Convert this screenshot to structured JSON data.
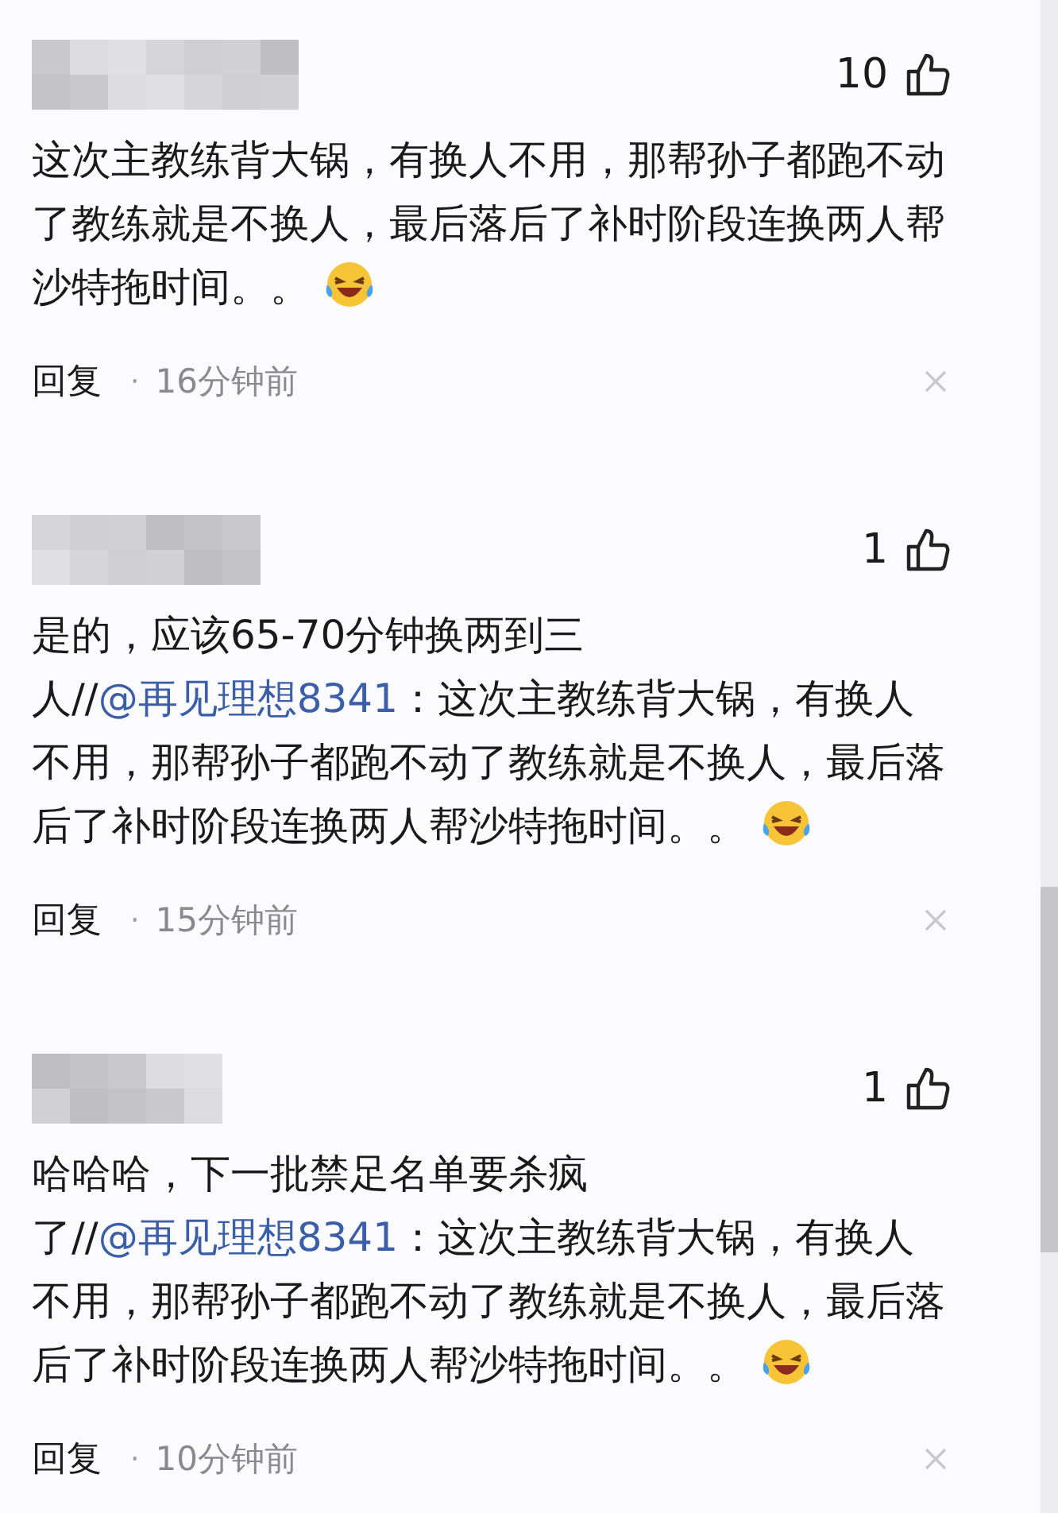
{
  "comments": [
    {
      "likes": "10",
      "segments": [
        {
          "kind": "plain",
          "text": "这次主教练背大锅，有换人不用，那帮孙子都跑不动了教练就是不换人，最后落后了补时阶段连换两人帮沙特拖时间。。"
        },
        {
          "kind": "emoji"
        }
      ],
      "reply": "回复",
      "separator": "·",
      "time": "16分钟前"
    },
    {
      "likes": "1",
      "segments": [
        {
          "kind": "plain",
          "text": "是的，应该65-70分钟换两到三人//"
        },
        {
          "kind": "mention",
          "text": "@再见理想8341"
        },
        {
          "kind": "plain",
          "text": "：这次主教练背大锅，有换人不用，那帮孙子都跑不动了教练就是不换人，最后落后了补时阶段连换两人帮沙特拖时间。。"
        },
        {
          "kind": "emoji"
        }
      ],
      "reply": "回复",
      "separator": "·",
      "time": "15分钟前"
    },
    {
      "likes": "1",
      "segments": [
        {
          "kind": "plain",
          "text": "哈哈哈，下一批禁足名单要杀疯了//"
        },
        {
          "kind": "mention",
          "text": "@再见理想8341"
        },
        {
          "kind": "plain",
          "text": "：这次主教练背大锅，有换人不用，那帮孙子都跑不动了教练就是不换人，最后落后了补时阶段连换两人帮沙特拖时间。。"
        },
        {
          "kind": "emoji"
        }
      ],
      "reply": "回复",
      "separator": "·",
      "time": "10分钟前"
    }
  ]
}
